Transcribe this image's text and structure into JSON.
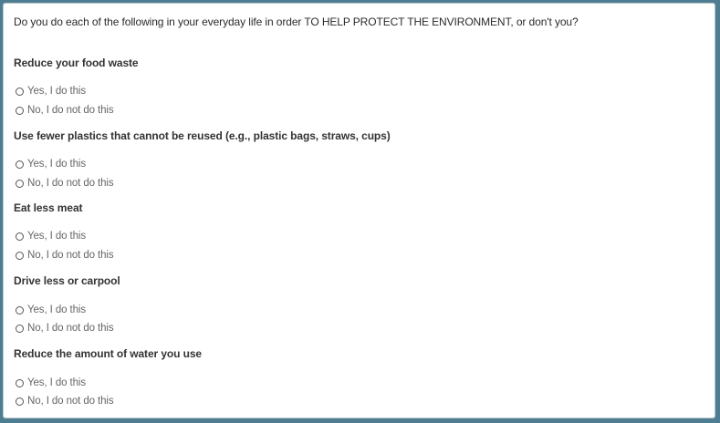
{
  "question": "Do you do each of the following in your everyday life in order TO HELP PROTECT THE ENVIRONMENT, or don't you?",
  "options": {
    "yes": "Yes, I do this",
    "no": "No, I do not do this"
  },
  "items": [
    {
      "label": "Reduce your food waste"
    },
    {
      "label": "Use fewer plastics that cannot be reused (e.g., plastic bags, straws, cups)"
    },
    {
      "label": "Eat less meat"
    },
    {
      "label": "Drive less or carpool"
    },
    {
      "label": "Reduce the amount of water you use"
    }
  ]
}
